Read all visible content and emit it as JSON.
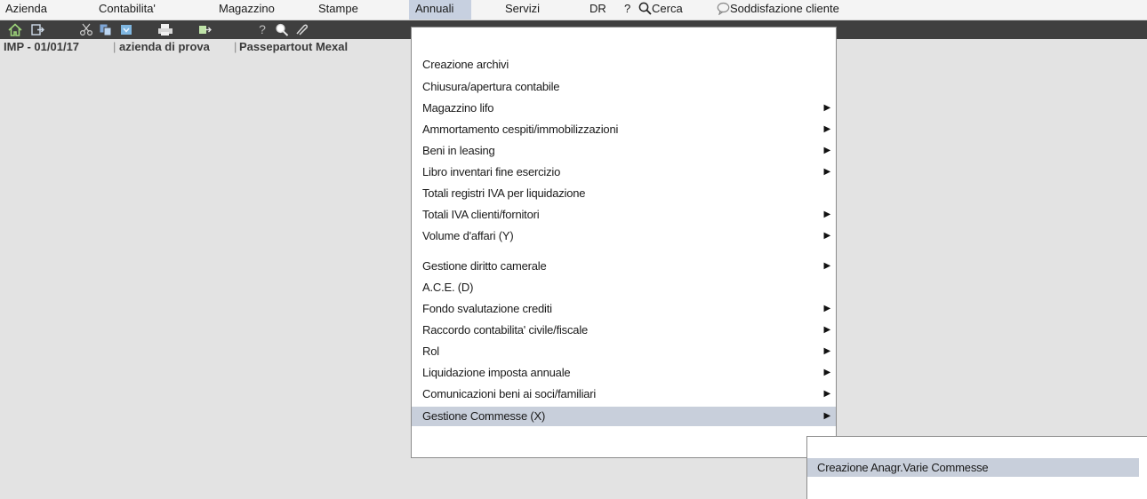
{
  "menubar": {
    "items": [
      {
        "label": "Azienda"
      },
      {
        "label": "Contabilita'"
      },
      {
        "label": "Magazzino"
      },
      {
        "label": "Stampe"
      },
      {
        "label": "Annuali",
        "active": true
      },
      {
        "label": "Servizi"
      },
      {
        "label": "DR"
      },
      {
        "label": "?"
      },
      {
        "label": "Cerca"
      },
      {
        "label": "Soddisfazione cliente"
      }
    ]
  },
  "toolbar": {
    "icons": [
      "home-icon",
      "exit-icon",
      "cut-icon",
      "copy-icon",
      "paste-icon",
      "print-icon",
      "export-icon",
      "help-icon",
      "zoom-icon",
      "attach-icon"
    ]
  },
  "infobar": {
    "code": "IMP - 01/01/17",
    "company": "azienda di prova",
    "product": "Passepartout Mexal"
  },
  "dropdown": {
    "items": [
      {
        "label": "Creazione archivi",
        "submenu": false
      },
      {
        "label": "Chiusura/apertura contabile",
        "submenu": false
      },
      {
        "label": "Magazzino lifo",
        "submenu": true
      },
      {
        "label": "Ammortamento cespiti/immobilizzazioni",
        "submenu": true
      },
      {
        "label": "Beni in leasing",
        "submenu": true
      },
      {
        "label": "Libro inventari fine esercizio",
        "submenu": true
      },
      {
        "label": "Totali registri IVA per liquidazione",
        "submenu": false
      },
      {
        "label": "Totali IVA clienti/fornitori",
        "submenu": true
      },
      {
        "label": "Volume d'affari (Y)",
        "submenu": true
      },
      {
        "label": "Gestione diritto camerale",
        "submenu": true
      },
      {
        "label": "A.C.E. (D)",
        "submenu": false
      },
      {
        "label": "Fondo svalutazione crediti",
        "submenu": true
      },
      {
        "label": "Raccordo contabilita' civile/fiscale",
        "submenu": true
      },
      {
        "label": "Rol",
        "submenu": true
      },
      {
        "label": "Liquidazione imposta annuale",
        "submenu": true
      },
      {
        "label": "Comunicazioni beni ai soci/familiari",
        "submenu": true
      },
      {
        "label": "Gestione Commesse (X)",
        "submenu": true,
        "active": true
      }
    ]
  },
  "submenu": {
    "items": [
      {
        "label": "Creazione Anagr.Varie Commesse",
        "active": true
      }
    ]
  },
  "colors": {
    "toolbar_bg": "#3f3f3f",
    "highlight": "#c8cfdb",
    "background": "#e3e3e3"
  }
}
